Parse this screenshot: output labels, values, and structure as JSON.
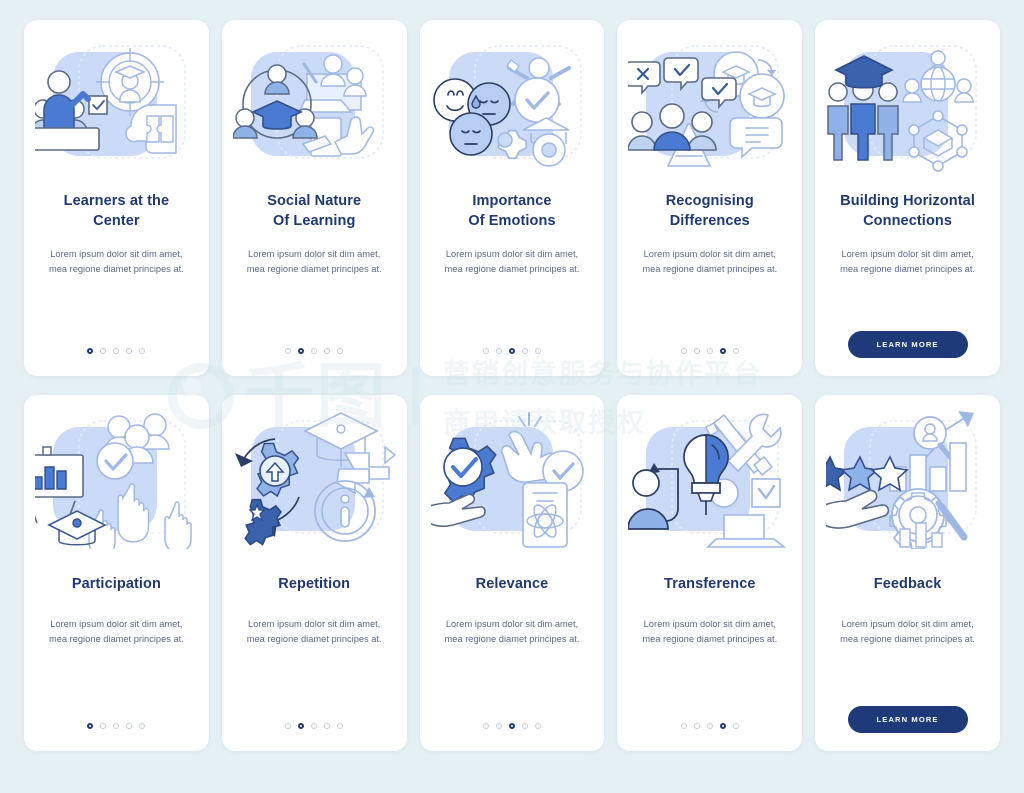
{
  "background_color": "#e4f0f4",
  "theme": {
    "title_color": "#1f3a6e",
    "body_color": "#5d6b87",
    "accent": "#4a7ad1",
    "button_bg": "#1f3a78",
    "card_bg": "#ffffff"
  },
  "watermark": {
    "logo_glyph": "千图",
    "line1": "营销创意服务与协作平台",
    "line2": "商用请获取授权"
  },
  "common": {
    "body_text": "Lorem ipsum dolor sit dim amet, mea regione diamet principes at.",
    "learn_more_label": "LEARN MORE",
    "dot_count": 5
  },
  "rows": [
    {
      "cards": [
        {
          "id": "learners-at-the-center",
          "title": "Learners at the\nCenter",
          "body": "Lorem ipsum dolor sit dim amet, mea regione diamet principes at.",
          "active_dot": 1,
          "has_button": false,
          "illustration": "teacher-at-desk-target-puzzle-head-icon"
        },
        {
          "id": "social-nature-of-learning",
          "title": "Social Nature\nOf Learning",
          "body": "Lorem ipsum dolor sit dim amet, mea regione diamet principes at.",
          "active_dot": 2,
          "has_button": false,
          "illustration": "group-circle-graduation-cap-writing-hand-icon"
        },
        {
          "id": "importance-of-emotions",
          "title": "Importance\nOf Emotions",
          "body": "Lorem ipsum dolor sit dim amet, mea regione diamet principes at.",
          "active_dot": 3,
          "has_button": false,
          "illustration": "emoji-faces-checkmark-gears-graduation-icon"
        },
        {
          "id": "recognising-differences",
          "title": "Recognising\nDifferences",
          "body": "Lorem ipsum dolor sit dim amet, mea regione diamet principes at.",
          "active_dot": 4,
          "has_button": false,
          "illustration": "people-speech-bubbles-graduation-caps-icon"
        },
        {
          "id": "building-horizontal-connections",
          "title": "Building Horizontal\nConnections",
          "body": "Lorem ipsum dolor sit dim amet, mea regione diamet principes at.",
          "active_dot": 0,
          "has_button": true,
          "button_label": "LEARN MORE",
          "illustration": "three-people-graduation-cap-network-globe-icon"
        }
      ]
    },
    {
      "cards": [
        {
          "id": "participation",
          "title": "Participation",
          "body": "Lorem ipsum dolor sit dim amet, mea regione diamet principes at.",
          "active_dot": 1,
          "has_button": false,
          "illustration": "presentation-chart-raised-hands-check-icon"
        },
        {
          "id": "repetition",
          "title": "Repetition",
          "body": "Lorem ipsum dolor sit dim amet, mea regione diamet principes at.",
          "active_dot": 2,
          "has_button": false,
          "illustration": "gears-cycle-arrows-info-graduation-cap-icon"
        },
        {
          "id": "relevance",
          "title": "Relevance",
          "body": "Lorem ipsum dolor sit dim amet, mea regione diamet principes at.",
          "active_dot": 3,
          "has_button": false,
          "illustration": "gear-check-hand-cursor-book-atom-icon"
        },
        {
          "id": "transference",
          "title": "Transference",
          "body": "Lorem ipsum dolor sit dim amet, mea regione diamet principes at.",
          "active_dot": 4,
          "has_button": false,
          "illustration": "lightbulb-person-wrench-pencil-laptop-icon"
        },
        {
          "id": "feedback",
          "title": "Feedback",
          "body": "Lorem ipsum dolor sit dim amet, mea regione diamet principes at.",
          "active_dot": 0,
          "has_button": true,
          "button_label": "LEARN MORE",
          "illustration": "stars-hand-magnifier-growth-chart-gear-icon"
        }
      ]
    }
  ]
}
